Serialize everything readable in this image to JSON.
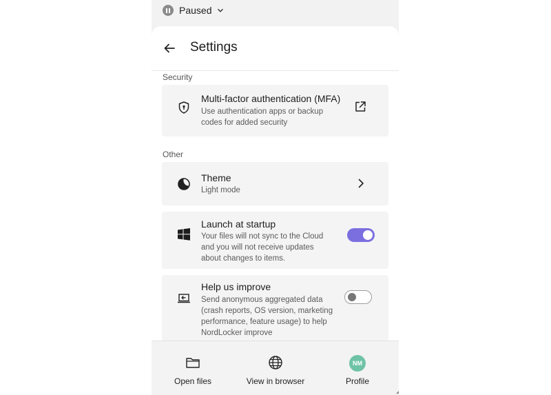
{
  "status": {
    "label": "Paused"
  },
  "header": {
    "title": "Settings"
  },
  "sections": {
    "security": "Security",
    "other": "Other"
  },
  "mfa": {
    "title": "Multi-factor authentication (MFA)",
    "desc_line1": "Use authentication apps or backup",
    "desc_line2": "codes for added security"
  },
  "theme": {
    "title": "Theme",
    "value": "Light mode"
  },
  "startup": {
    "title": "Launch at startup",
    "desc_line1": "Your files will not sync to the Cloud",
    "desc_line2": "and you will not receive updates",
    "desc_line3": "about changes to items.",
    "enabled": true
  },
  "improve": {
    "title": "Help us improve",
    "desc_line1": "Send anonymous aggregated data",
    "desc_line2": "(crash reports, OS version, marketing",
    "desc_line3": "performance, feature usage) to help",
    "desc_line4": "NordLocker improve",
    "enabled": false
  },
  "nav": {
    "open_files": "Open files",
    "view_browser": "View in browser",
    "profile": "Profile",
    "avatar_initials": "NM"
  },
  "colors": {
    "accent": "#7b6fe0",
    "avatar": "#6ec3a7"
  }
}
